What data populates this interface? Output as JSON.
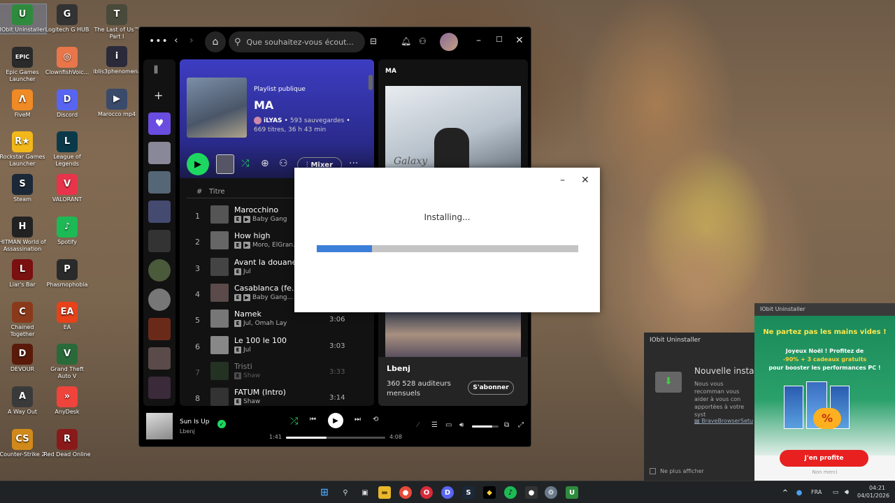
{
  "desktop_icons": [
    {
      "label": "IObit Uninstaller",
      "glyph": "U",
      "color": "#2e8b3d"
    },
    {
      "label": "Epic Games Launcher",
      "glyph": "EPIC",
      "color": "#2a2a2a"
    },
    {
      "label": "FiveM",
      "glyph": "Λ",
      "color": "#f08a24"
    },
    {
      "label": "Rockstar Games Launcher",
      "glyph": "R★",
      "color": "#f2b81a"
    },
    {
      "label": "Steam",
      "glyph": "S",
      "color": "#1b2838"
    },
    {
      "label": "HITMAN World of Assassination",
      "glyph": "H",
      "color": "#222"
    },
    {
      "label": "Liar's Bar",
      "glyph": "L",
      "color": "#7a1010"
    },
    {
      "label": "Chained Together",
      "glyph": "C",
      "color": "#8a3a1a"
    },
    {
      "label": "DEVOUR",
      "glyph": "D",
      "color": "#5a1a0a"
    },
    {
      "label": "A Way Out",
      "glyph": "A",
      "color": "#3a3a3a"
    },
    {
      "label": "Counter-Strike 2",
      "glyph": "CS",
      "color": "#d18a1a"
    },
    {
      "label": "Logitech G HUB",
      "glyph": "G",
      "color": "#333"
    },
    {
      "label": "ClownfishVoic...",
      "glyph": "◎",
      "color": "#e8764a"
    },
    {
      "label": "Discord",
      "glyph": "D",
      "color": "#5865f2"
    },
    {
      "label": "League of Legends",
      "glyph": "L",
      "color": "#0a3a4a"
    },
    {
      "label": "VALORANT",
      "glyph": "V",
      "color": "#e8344a"
    },
    {
      "label": "Spotify",
      "glyph": "♪",
      "color": "#1db954"
    },
    {
      "label": "Phasmophobia",
      "glyph": "P",
      "color": "#2a2a2a"
    },
    {
      "label": "EA",
      "glyph": "EA",
      "color": "#e8421a"
    },
    {
      "label": "Grand Theft Auto V",
      "glyph": "V",
      "color": "#2a6a3a"
    },
    {
      "label": "AnyDesk",
      "glyph": "»",
      "color": "#ef443b"
    },
    {
      "label": "Red Dead Online",
      "glyph": "R",
      "color": "#8a1a1a"
    },
    {
      "label": "The Last of Us™ Part I",
      "glyph": "T",
      "color": "#4a4a3a"
    },
    {
      "label": "iblis3phenomena",
      "glyph": "i",
      "color": "#2a2a3a"
    },
    {
      "label": "Marocco mp4",
      "glyph": "▶",
      "color": "#3a4a6a"
    }
  ],
  "spotify": {
    "search_placeholder": "Que souhaitez-vous écout...",
    "playlist_type": "Playlist publique",
    "playlist_title": "MA",
    "owner": "iLYAS",
    "saves": "593 sauvegardes",
    "meta": "669 titres, 36 h 43 min",
    "mixer_label": "Mixer",
    "col_num": "#",
    "col_title": "Titre",
    "tracks": [
      {
        "n": "1",
        "title": "Marocchino",
        "artist": "Baby Gang",
        "dur": "",
        "video": true
      },
      {
        "n": "2",
        "title": "How high",
        "artist": "Moro, ElGran...",
        "dur": "",
        "video": true
      },
      {
        "n": "3",
        "title": "Avant la douane",
        "artist": "Jul",
        "dur": "",
        "video": false
      },
      {
        "n": "4",
        "title": "Casablanca (fe...",
        "artist": "Baby Gang...",
        "dur": "",
        "video": true
      },
      {
        "n": "5",
        "title": "Namek",
        "artist": "Jul, Omah Lay",
        "dur": "3:06",
        "video": false
      },
      {
        "n": "6",
        "title": "Le 100 le 100",
        "artist": "Jul",
        "dur": "3:03",
        "video": false
      },
      {
        "n": "7",
        "title": "Tristi",
        "artist": "Shaw",
        "dur": "3:33",
        "video": false
      },
      {
        "n": "8",
        "title": "FATUM (Intro)",
        "artist": "Shaw",
        "dur": "3:14",
        "video": false
      }
    ],
    "right_title": "MA",
    "right_cover_text": "Galaxy",
    "artist_name": "Lbenj",
    "listeners": "360 528 auditeurs mensuels",
    "follow_label": "S'abonner",
    "now_title": "Sun Is Up",
    "now_artist": "Lbenj",
    "elapsed": "1:41",
    "total": "4:08",
    "progress": 0.41,
    "volume": 0.75
  },
  "installer": {
    "status": "Installing...",
    "progress": 0.21,
    "accent": "#3c7fd8"
  },
  "notif": {
    "app": "IObit Uninstaller",
    "title": "Nouvelle installa",
    "body": "Nous vous recomman vous aider à vous con apportées à votre syst",
    "file": "BraveBrowserSetu",
    "checkbox": "Ne plus afficher"
  },
  "promo": {
    "app": "IObit Uninstaller",
    "headline": "Ne partez pas les mains vides !",
    "line1": "Joyeux Noël ! Profitez de",
    "line2": "-90% + 3 cadeaux gratuits",
    "line3": "pour booster les performances PC !",
    "cta": "J'en profite",
    "dismiss": "Non merci"
  },
  "taskbar": {
    "lang": "FRA",
    "time": "04:21",
    "date": "04/01/2026"
  }
}
